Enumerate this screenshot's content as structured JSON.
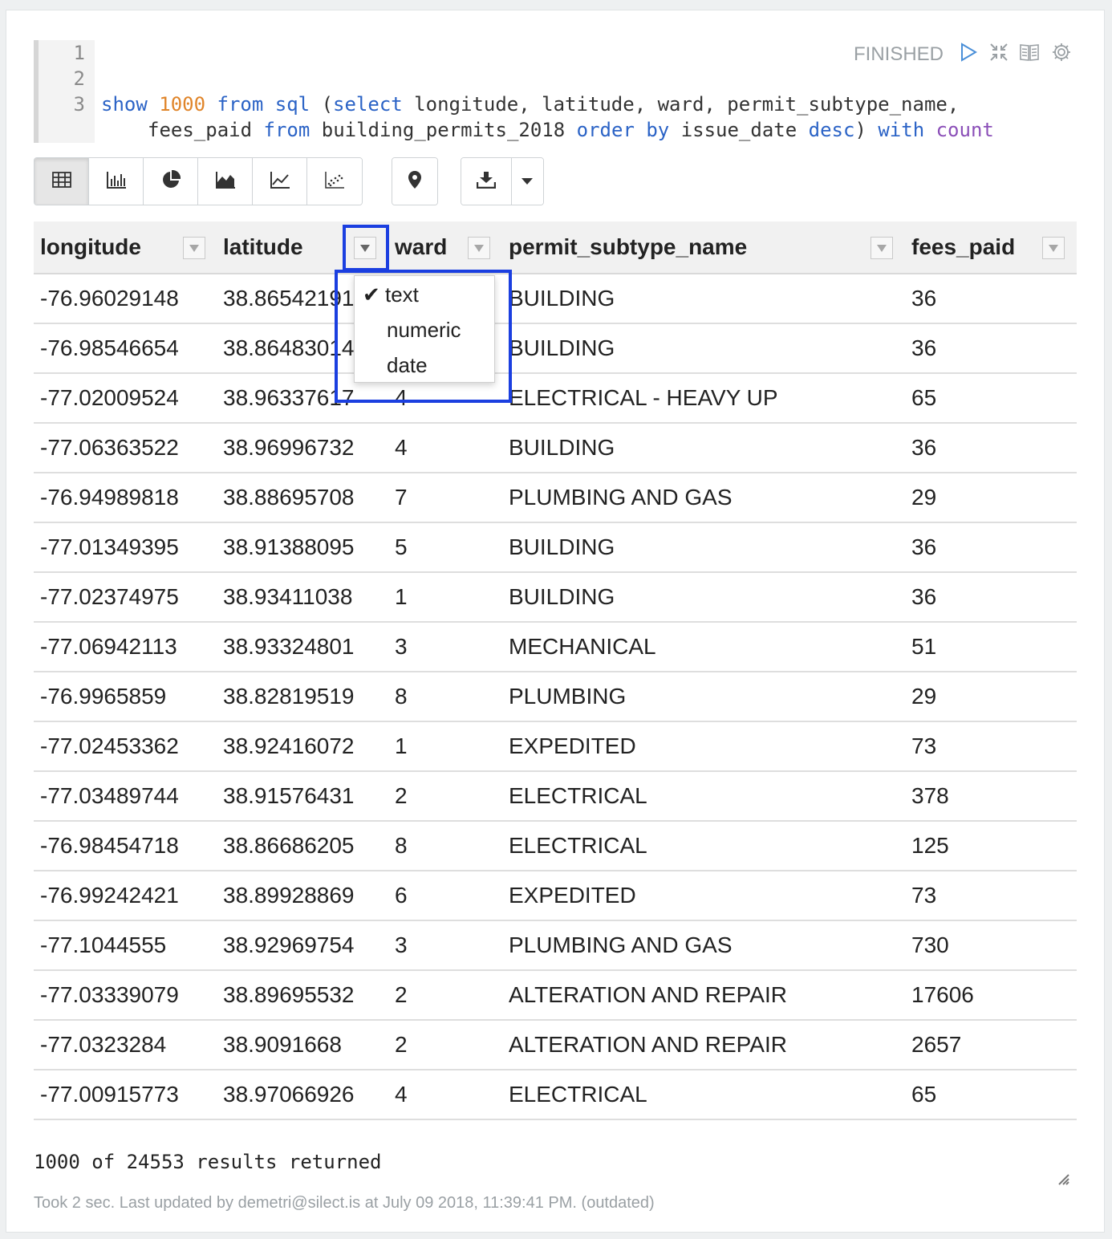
{
  "editor": {
    "line_numbers": [
      "1",
      "2",
      "3"
    ],
    "code": {
      "show": "show",
      "limit": "1000",
      "from1": "from",
      "sql": "sql",
      "paren_open": "(",
      "select": "select",
      "cols": "longitude, latitude, ward, permit_subtype_name,",
      "fees": "fees_paid",
      "from2": "from",
      "table": "building_permits_2018",
      "orderby": "order by",
      "col_issue": "issue_date",
      "desc": "desc",
      "paren_close": ")",
      "with": "with",
      "count": "count"
    }
  },
  "header": {
    "status": "FINISHED",
    "icons": [
      "run-icon",
      "collapse-icon",
      "book-icon",
      "gear-icon"
    ]
  },
  "toolbar": {
    "chart_buttons": [
      "table-icon",
      "bar-chart-icon",
      "pie-chart-icon",
      "area-chart-icon",
      "line-chart-icon",
      "scatter-chart-icon"
    ],
    "map_button": "map-pin-icon",
    "download_buttons": [
      "download-icon",
      "caret-down-icon"
    ]
  },
  "table": {
    "columns": [
      "longitude",
      "latitude",
      "ward",
      "permit_subtype_name",
      "fees_paid"
    ],
    "rows": [
      [
        "-76.96029148",
        "38.86542191",
        "",
        "BUILDING",
        "36"
      ],
      [
        "-76.98546654",
        "38.86483014",
        "",
        "BUILDING",
        "36"
      ],
      [
        "-77.02009524",
        "38.96337617",
        "4",
        "ELECTRICAL - HEAVY UP",
        "65"
      ],
      [
        "-77.06363522",
        "38.96996732",
        "4",
        "BUILDING",
        "36"
      ],
      [
        "-76.94989818",
        "38.88695708",
        "7",
        "PLUMBING AND GAS",
        "29"
      ],
      [
        "-77.01349395",
        "38.91388095",
        "5",
        "BUILDING",
        "36"
      ],
      [
        "-77.02374975",
        "38.93411038",
        "1",
        "BUILDING",
        "36"
      ],
      [
        "-77.06942113",
        "38.93324801",
        "3",
        "MECHANICAL",
        "51"
      ],
      [
        "-76.9965859",
        "38.82819519",
        "8",
        "PLUMBING",
        "29"
      ],
      [
        "-77.02453362",
        "38.92416072",
        "1",
        "EXPEDITED",
        "73"
      ],
      [
        "-77.03489744",
        "38.91576431",
        "2",
        "ELECTRICAL",
        "378"
      ],
      [
        "-76.98454718",
        "38.86686205",
        "8",
        "ELECTRICAL",
        "125"
      ],
      [
        "-76.99242421",
        "38.89928869",
        "6",
        "EXPEDITED",
        "73"
      ],
      [
        "-77.1044555",
        "38.92969754",
        "3",
        "PLUMBING AND GAS",
        "730"
      ],
      [
        "-77.03339079",
        "38.89695532",
        "2",
        "ALTERATION AND REPAIR",
        "17606"
      ],
      [
        "-77.0323284",
        "38.9091668",
        "2",
        "ALTERATION AND REPAIR",
        "2657"
      ],
      [
        "-77.00915773",
        "38.97066926",
        "4",
        "ELECTRICAL",
        "65"
      ]
    ]
  },
  "type_menu": {
    "items": [
      "text",
      "numeric",
      "date"
    ],
    "selected": "text",
    "check_glyph": "✔"
  },
  "footer": {
    "count": "1000 of 24553 results returned",
    "meta": "Took 2 sec. Last updated by demetri@silect.is at July 09 2018, 11:39:41 PM. (outdated)"
  },
  "colors": {
    "keyword": "#2b63c6",
    "number": "#e0852a",
    "keyword2": "#8b4fb8",
    "highlight": "#1b3fe0"
  }
}
